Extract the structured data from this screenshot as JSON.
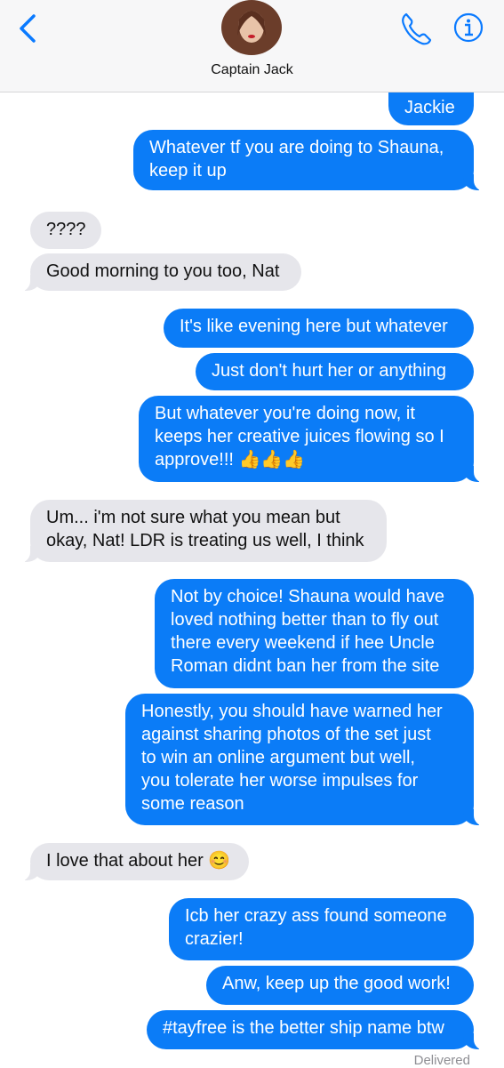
{
  "header": {
    "contact_name": "Captain Jack",
    "icons": [
      "chevron-left-icon",
      "phone-icon",
      "info-icon"
    ]
  },
  "messages": [
    {
      "from": "me",
      "text": "Jackie"
    },
    {
      "from": "me",
      "text": "Whatever tf you are doing to Shauna,\nkeep it up"
    },
    {
      "from": "them",
      "text": "????"
    },
    {
      "from": "them",
      "text": "Good morning to you too, Nat"
    },
    {
      "from": "me",
      "text": "It's like evening here but whatever"
    },
    {
      "from": "me",
      "text": "Just don't hurt her or anything"
    },
    {
      "from": "me",
      "text": "But whatever you're doing now, it\nkeeps her creative juices flowing so I\napprove!!! 👍👍👍"
    },
    {
      "from": "them",
      "text": "Um... i'm not sure what you mean but\nokay, Nat! LDR is treating us well, I think"
    },
    {
      "from": "me",
      "text": "Not by choice! Shauna would have\nloved nothing better than to fly out\nthere every weekend if hee Uncle\nRoman didnt ban her from the site"
    },
    {
      "from": "me",
      "text": "Honestly, you should have warned her\nagainst sharing photos of the set just\nto win an online argument but well,\nyou tolerate her worse impulses for\nsome reason"
    },
    {
      "from": "them",
      "text": "I love that about her 😊"
    },
    {
      "from": "me",
      "text": "Icb her crazy ass found someone\ncrazier!"
    },
    {
      "from": "me",
      "text": "Anw, keep up the good work!"
    },
    {
      "from": "me",
      "text": "#tayfree is the better ship name btw"
    }
  ],
  "status": "Delivered",
  "colors": {
    "sent_bubble": "#0b7cf7",
    "received_bubble": "#e6e6eb",
    "accent": "#0a7aff"
  }
}
